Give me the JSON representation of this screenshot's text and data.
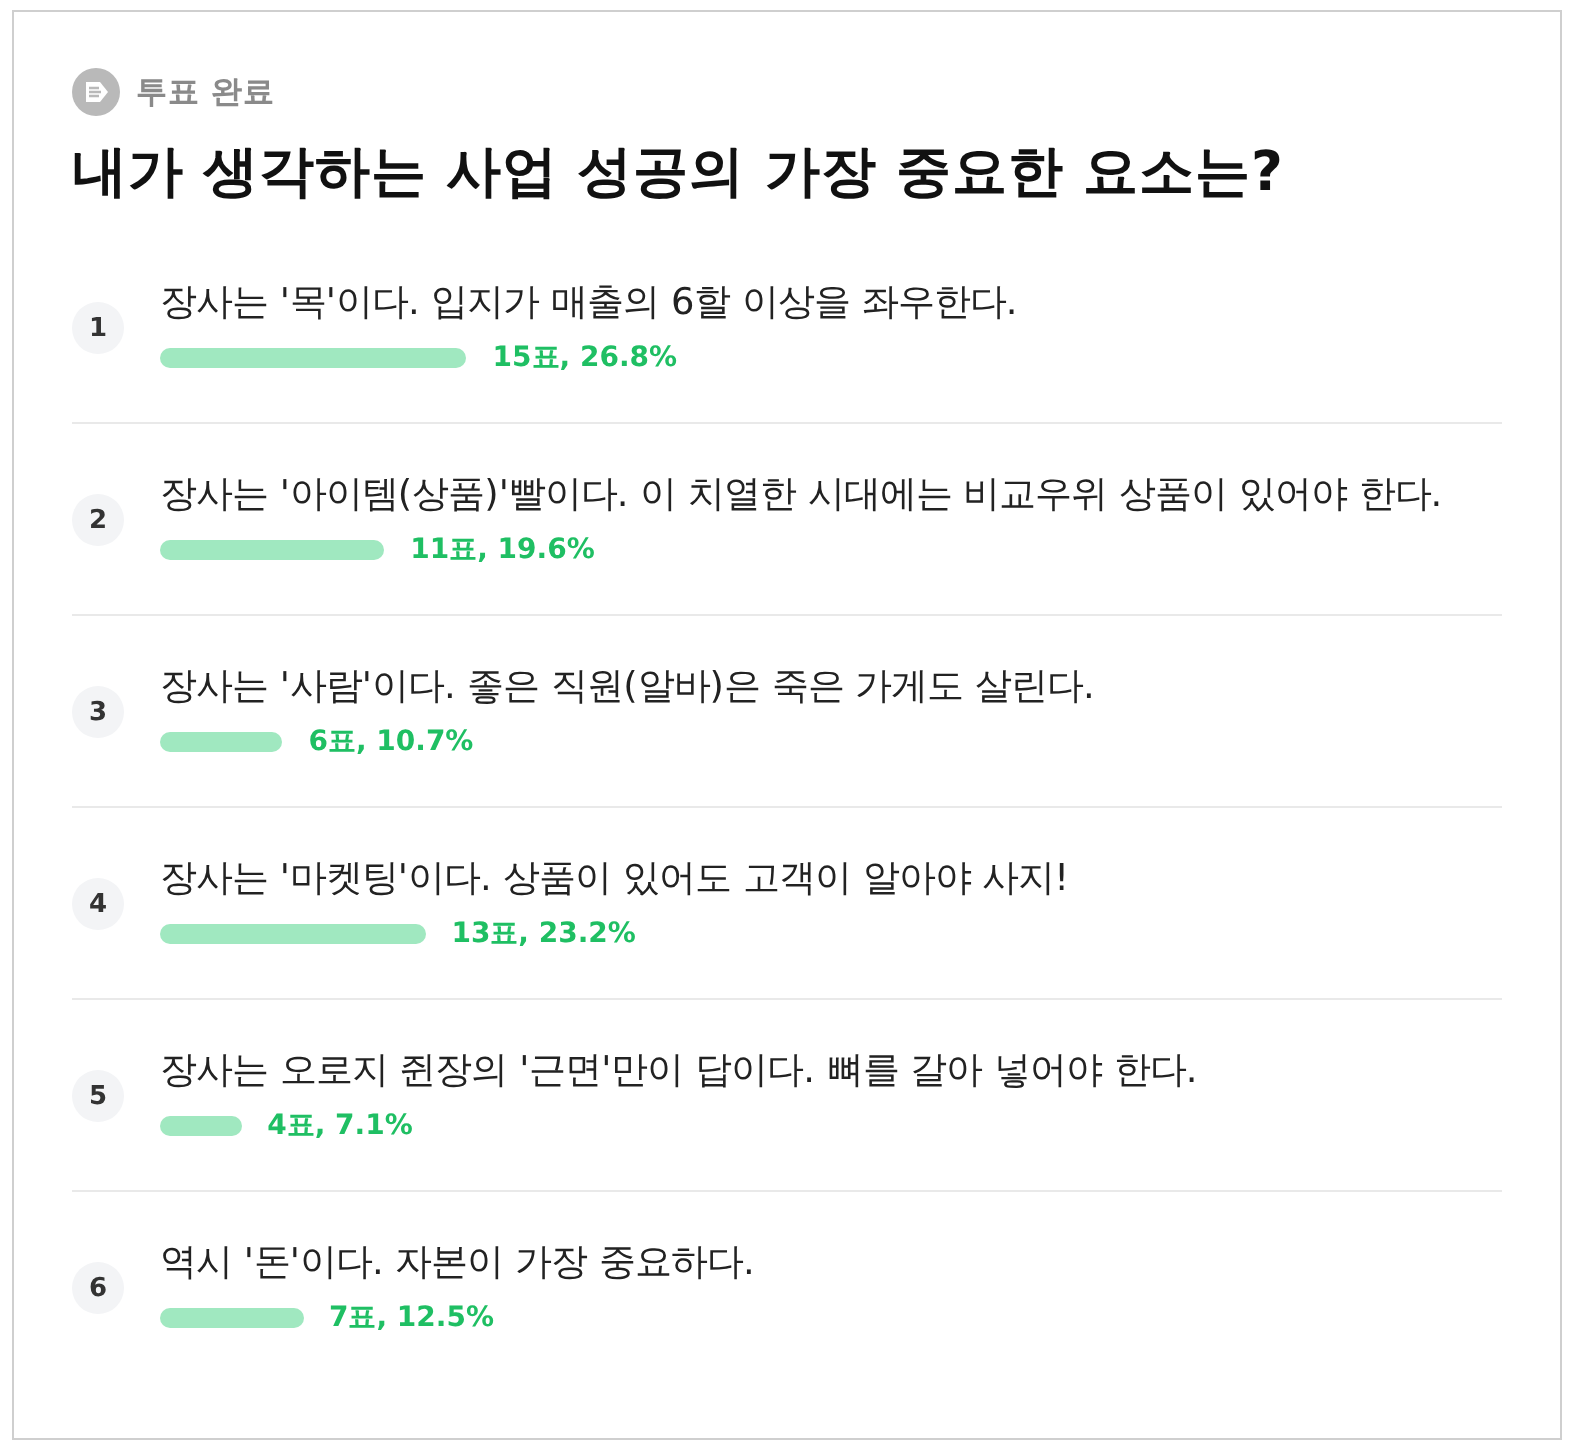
{
  "status": {
    "label": "투표 완료"
  },
  "question": "내가 생각하는 사업 성공의 가장 중요한 요소는?",
  "options": [
    {
      "number": "1",
      "text": "장사는 '목'이다. 입지가 매출의 6할 이상을 좌우한다.",
      "level": 0.268,
      "result": "15표, 26.8%"
    },
    {
      "number": "2",
      "text": "장사는 '아이템(상품)'빨이다. 이 치열한 시대에는 비교우위 상품이 있어야 한다.",
      "level": 0.196,
      "result": "11표, 19.6%"
    },
    {
      "number": "3",
      "text": "장사는 '사람'이다. 좋은 직원(알바)은 죽은 가게도 살린다.",
      "level": 0.107,
      "result": "6표, 10.7%"
    },
    {
      "number": "4",
      "text": "장사는 '마켓팅'이다. 상품이 있어도 고객이 알아야 사지!",
      "level": 0.232,
      "result": "13표, 23.2%"
    },
    {
      "number": "5",
      "text": "장사는 오로지 쥔장의 '근면'만이 답이다. 뼈를 갈아 넣어야 한다.",
      "level": 0.071,
      "result": "4표, 7.1%"
    },
    {
      "number": "6",
      "text": "역시 '돈'이다. 자본이 가장 중요하다.",
      "level": 0.125,
      "result": "7표, 12.5%"
    }
  ]
}
